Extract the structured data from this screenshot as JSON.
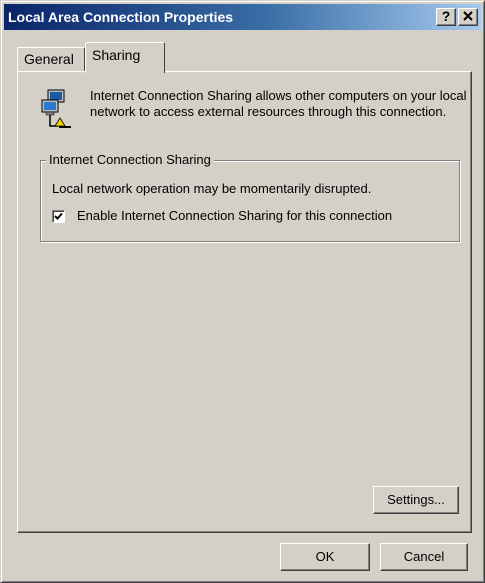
{
  "window": {
    "title": "Local Area Connection Properties",
    "help_label": "?",
    "close_label": "✕"
  },
  "tabs": [
    {
      "label": "General",
      "selected": false
    },
    {
      "label": "Sharing",
      "selected": true
    }
  ],
  "sharing": {
    "icon": "network-connection-icon",
    "description": "Internet Connection Sharing allows other computers on your local network to access external resources through this connection.",
    "group_label": "Internet Connection Sharing",
    "disruption_text": "Local network operation may be momentarily disrupted.",
    "enable_label": "Enable Internet Connection Sharing for this connection",
    "enable_checked": true,
    "settings_label": "Settings..."
  },
  "footer": {
    "ok_label": "OK",
    "cancel_label": "Cancel"
  },
  "colors": {
    "title_gradient_start": "#0a246a",
    "title_gradient_end": "#a6caf0",
    "face": "#d4d0c8"
  }
}
